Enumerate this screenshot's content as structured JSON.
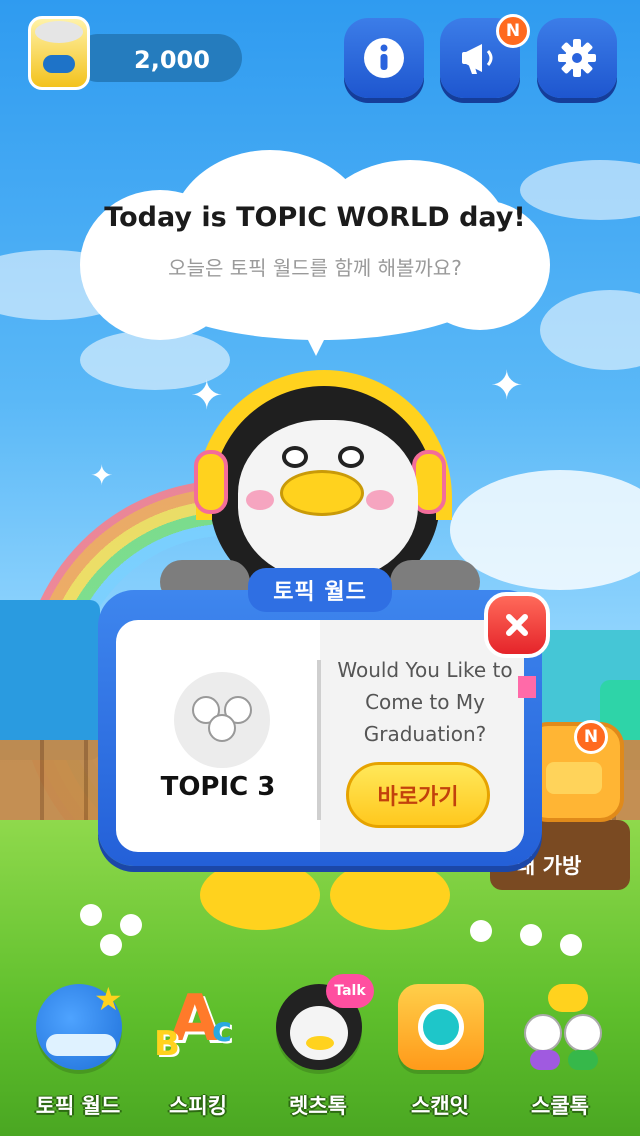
{
  "currency": {
    "label": "2,000"
  },
  "header": {
    "buttons": [
      {
        "name": "info",
        "icon": "info-icon"
      },
      {
        "name": "notice",
        "icon": "megaphone-icon",
        "badge": "N"
      },
      {
        "name": "settings",
        "icon": "gear-icon"
      }
    ]
  },
  "speech": {
    "title": "Today is TOPIC WORLD day!",
    "subtitle": "오늘은 토픽 월드를 함께 해볼까요?"
  },
  "modal": {
    "title": "토픽 월드",
    "topic_label": "TOPIC 3",
    "question": "Would You Like to Come to My Graduation?",
    "go_button": "바로가기",
    "close_icon": "close-icon"
  },
  "backpack": {
    "label": "내 가방",
    "badge": "N"
  },
  "nav": {
    "items": [
      {
        "label": "토픽 월드",
        "icon": "globe-airplane-icon",
        "color": "#1e6fd8"
      },
      {
        "label": "스피킹",
        "icon": "abc-blocks-icon",
        "color": "#ff8a2a"
      },
      {
        "label": "렛츠톡",
        "icon": "penguin-talk-icon",
        "color": "#222222"
      },
      {
        "label": "스캔잇",
        "icon": "camera-icon",
        "color": "#ffb12a"
      },
      {
        "label": "스쿨톡",
        "icon": "friends-chat-icon",
        "color": "#ffffff"
      }
    ]
  },
  "colors": {
    "sky": "#3ea6f5",
    "primary_button": "#2a63dd",
    "badge": "#ff6a1f",
    "close": "#e5242a",
    "go": "#ffd42a"
  }
}
